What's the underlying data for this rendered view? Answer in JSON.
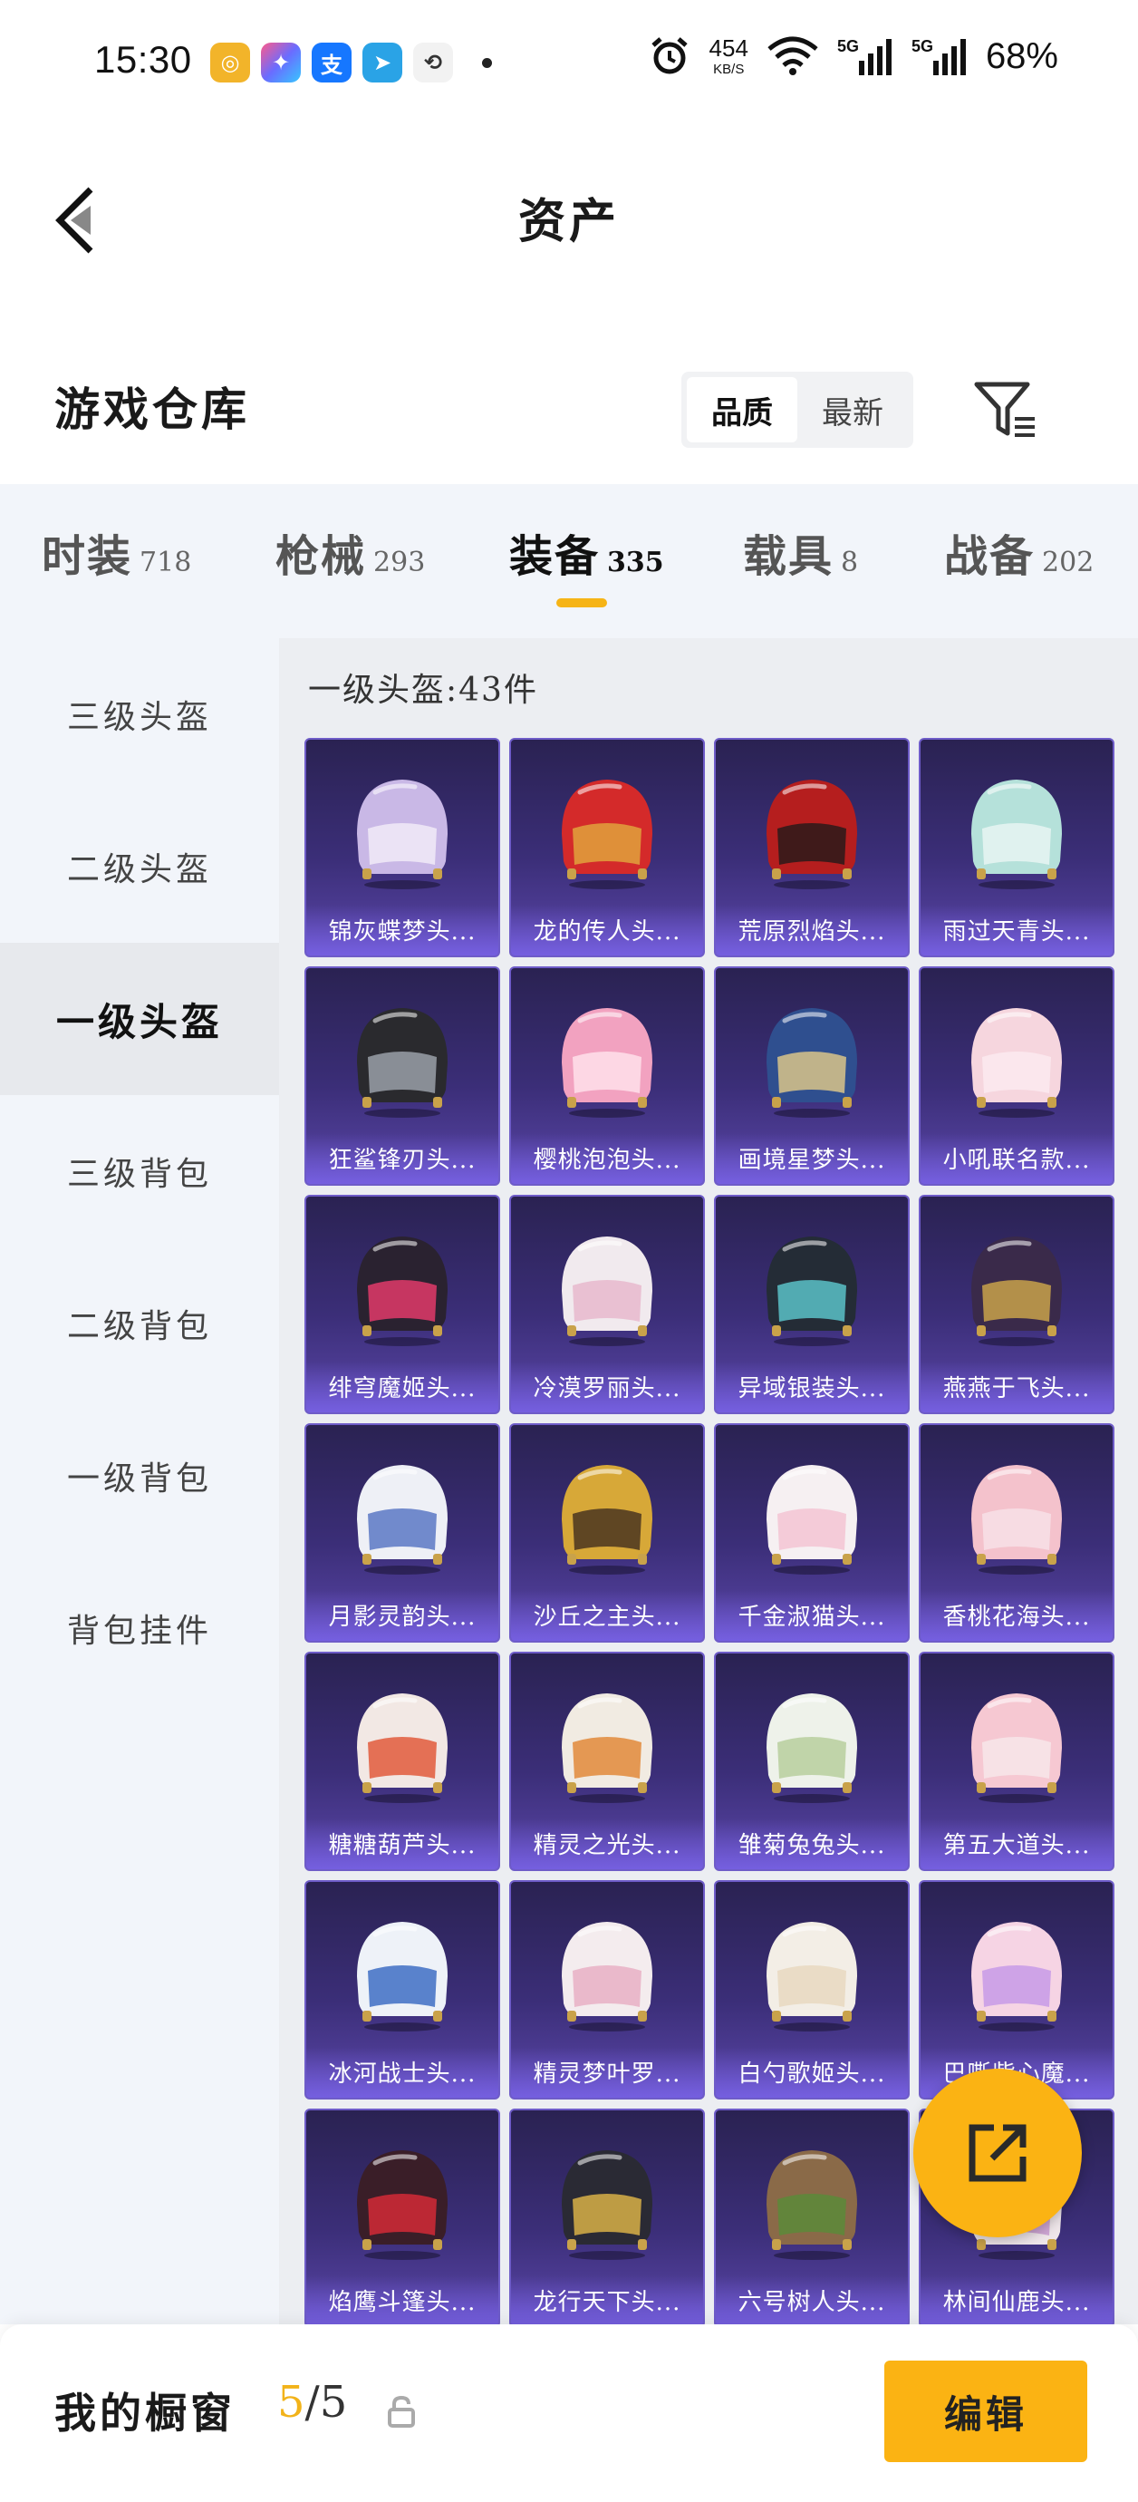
{
  "status": {
    "time": "15:30",
    "net_speed_value": "454",
    "net_speed_unit": "KB/S",
    "battery": "68%",
    "app_icons": [
      "tool-app-icon",
      "star-app-icon",
      "alipay-icon",
      "telegram-icon",
      "sync-app-icon"
    ]
  },
  "header": {
    "title": "资产"
  },
  "warehouse": {
    "title": "游戏仓库",
    "sort_options": [
      "品质",
      "最新"
    ],
    "selected_sort": "品质"
  },
  "tabs": [
    {
      "label": "时装",
      "count": "718"
    },
    {
      "label": "枪械",
      "count": "293"
    },
    {
      "label": "装备",
      "count": "335",
      "active": true
    },
    {
      "label": "载具",
      "count": "8"
    },
    {
      "label": "战备",
      "count": "202"
    }
  ],
  "sidebar": {
    "items": [
      "三级头盔",
      "二级头盔",
      "一级头盔",
      "三级背包",
      "二级背包",
      "一级背包",
      "背包挂件"
    ],
    "active_index": 2
  },
  "main": {
    "section_title": "一级头盔:43件",
    "items": [
      {
        "name": "锦灰蝶梦头...",
        "color": "#c9b8e6",
        "accent": "#f1eaf7"
      },
      {
        "name": "龙的传人头...",
        "color": "#d42a2a",
        "accent": "#e0a23c"
      },
      {
        "name": "荒原烈焰头...",
        "color": "#b51e1e",
        "accent": "#2a1a1a"
      },
      {
        "name": "雨过天青头...",
        "color": "#b5e1da",
        "accent": "#e8f4f2"
      },
      {
        "name": "狂鲨锋刃头...",
        "color": "#2a2a2e",
        "accent": "#9aa0a8"
      },
      {
        "name": "樱桃泡泡头...",
        "color": "#f2a2c0",
        "accent": "#ffe0ea"
      },
      {
        "name": "画境星梦头...",
        "color": "#2f4f8f",
        "accent": "#d9c48a"
      },
      {
        "name": "小吼联名款...",
        "color": "#f6d6de",
        "accent": "#fbeaf0"
      },
      {
        "name": "绯穹魔姬头...",
        "color": "#2a2230",
        "accent": "#e23a6a"
      },
      {
        "name": "冷漠罗丽头...",
        "color": "#f1eaee",
        "accent": "#e8b9cc"
      },
      {
        "name": "异域银装头...",
        "color": "#242c36",
        "accent": "#5bc2c8"
      },
      {
        "name": "燕燕于飞头...",
        "color": "#3a2a4a",
        "accent": "#c9a24a"
      },
      {
        "name": "月影灵韵头...",
        "color": "#eef0f6",
        "accent": "#5a78c4"
      },
      {
        "name": "沙丘之主头...",
        "color": "#d7a838",
        "accent": "#4a3520"
      },
      {
        "name": "千金淑猫头...",
        "color": "#f6f0f2",
        "accent": "#f3c4d4"
      },
      {
        "name": "香桃花海头...",
        "color": "#f4c2cc",
        "accent": "#f7e1e6"
      },
      {
        "name": "糖糖葫芦头...",
        "color": "#f2e8e4",
        "accent": "#e25a3c"
      },
      {
        "name": "精灵之光头...",
        "color": "#f1ebe2",
        "accent": "#e28a3a"
      },
      {
        "name": "雏菊兔兔头...",
        "color": "#eef2ea",
        "accent": "#b7cf9e"
      },
      {
        "name": "第五大道头...",
        "color": "#f6c8d2",
        "accent": "#f7e6ea"
      },
      {
        "name": "冰河战士头...",
        "color": "#eef2f8",
        "accent": "#3e6fc4"
      },
      {
        "name": "精灵梦叶罗...",
        "color": "#f4ecee",
        "accent": "#e8b0c4"
      },
      {
        "name": "白勺歌姬头...",
        "color": "#f3eee6",
        "accent": "#e8d8c0"
      },
      {
        "name": "巴嘶紫心魔...",
        "color": "#f6d4e4",
        "accent": "#c79ae8"
      },
      {
        "name": "焰鹰斗篷头...",
        "color": "#3a1e28",
        "accent": "#d42a36"
      },
      {
        "name": "龙行天下头...",
        "color": "#2a2a34",
        "accent": "#d8b048"
      },
      {
        "name": "六号树人头...",
        "color": "#8a6a48",
        "accent": "#5a8a3a"
      },
      {
        "name": "林间仙鹿头...",
        "color": "#efe6ea",
        "accent": "#c99ad0"
      }
    ]
  },
  "bottom": {
    "window_label": "我的橱窗",
    "window_current": "5",
    "window_separator": "/",
    "window_total": "5",
    "edit_label": "编辑"
  },
  "colors": {
    "accent": "#fbb313",
    "tab_underline": "#f6b416",
    "card_bg": "#3b2e78"
  }
}
